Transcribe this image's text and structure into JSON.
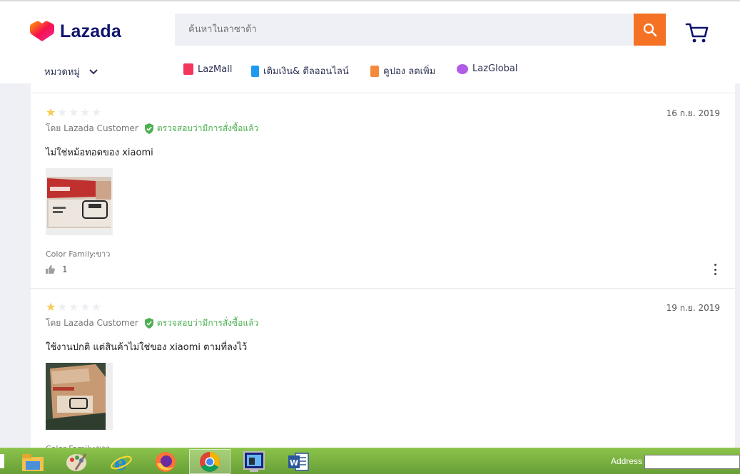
{
  "header": {
    "logo_text": "Lazada",
    "search_placeholder": "ค้นหาในลาซาด้า",
    "brand_color": "#f57224"
  },
  "nav": {
    "category_label": "หมวดหมู่",
    "items": [
      {
        "label": "LazMall",
        "icon": "lazmall-icon"
      },
      {
        "label": "เติมเงิน& ดีลออนไลน์",
        "icon": "topup-icon"
      },
      {
        "label": "คูปอง ลดเพิ่ม",
        "icon": "coupon-icon"
      },
      {
        "label": "LazGlobal",
        "icon": "lazglobal-icon"
      }
    ]
  },
  "reviews": [
    {
      "rating": 1,
      "max_rating": 5,
      "date": "16 ก.ย. 2019",
      "author": "โดย Lazada Customer",
      "verified": "ตรวจสอบว่ามีการสั่งซื้อแล้ว",
      "text": "ไม่ใช่หม้อทอดของ xiaomi",
      "variant": "Color Family:ขาว",
      "likes": "1"
    },
    {
      "rating": 1,
      "max_rating": 5,
      "date": "19 ก.ย. 2019",
      "author": "โดย Lazada Customer",
      "verified": "ตรวจสอบว่ามีการสั่งซื้อแล้ว",
      "text": "ใช้งานปกติ แต่สินค้าไม่ใช่ของ xiaomi ตามที่ลงไว้",
      "variant": "Color Family:ขาว"
    }
  ],
  "taskbar": {
    "apps": [
      "file-explorer-icon",
      "paint-icon",
      "internet-explorer-icon",
      "firefox-icon",
      "chrome-icon",
      "monitor-app-icon",
      "word-icon"
    ],
    "address_label": "Address"
  }
}
